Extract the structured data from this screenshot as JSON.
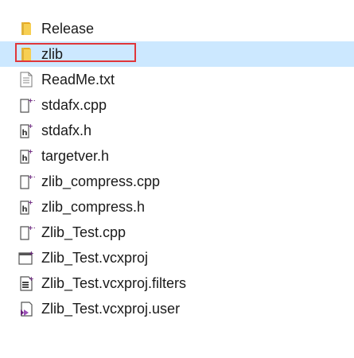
{
  "files": [
    {
      "name": "Release",
      "icon": "folder-icon",
      "selected": false
    },
    {
      "name": "zlib",
      "icon": "folder-icon",
      "selected": true
    },
    {
      "name": "ReadMe.txt",
      "icon": "text-file-icon",
      "selected": false
    },
    {
      "name": "stdafx.cpp",
      "icon": "cpp-file-icon",
      "selected": false
    },
    {
      "name": "stdafx.h",
      "icon": "header-file-icon",
      "selected": false
    },
    {
      "name": "targetver.h",
      "icon": "header-file-icon",
      "selected": false
    },
    {
      "name": "zlib_compress.cpp",
      "icon": "cpp-file-icon",
      "selected": false
    },
    {
      "name": "zlib_compress.h",
      "icon": "header-file-icon",
      "selected": false
    },
    {
      "name": "Zlib_Test.cpp",
      "icon": "cpp-file-icon",
      "selected": false
    },
    {
      "name": "Zlib_Test.vcxproj",
      "icon": "vcxproj-file-icon",
      "selected": false
    },
    {
      "name": "Zlib_Test.vcxproj.filters",
      "icon": "filters-file-icon",
      "selected": false
    },
    {
      "name": "Zlib_Test.vcxproj.user",
      "icon": "user-file-icon",
      "selected": false
    }
  ],
  "colors": {
    "selection": "#cce8ff",
    "highlight_border": "#e0363a",
    "folder": "#f3c33c",
    "accent": "#68217a"
  }
}
